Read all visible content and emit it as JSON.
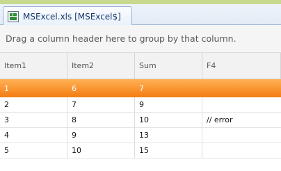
{
  "tab": {
    "label": "MSExcel.xls [MSExcel$]",
    "icon": "excel-sheet-icon"
  },
  "group_panel": {
    "text": "Drag a column header here to group by that column."
  },
  "grid": {
    "columns": [
      "Item1",
      "Item2",
      "Sum",
      "F4"
    ],
    "rows": [
      [
        "1",
        "6",
        "7",
        ""
      ],
      [
        "2",
        "7",
        "9",
        ""
      ],
      [
        "3",
        "8",
        "10",
        "// error"
      ],
      [
        "4",
        "9",
        "13",
        ""
      ],
      [
        "5",
        "10",
        "15",
        ""
      ]
    ],
    "selected_row": 0
  },
  "colors": {
    "selection_top": "#ffb155",
    "selection_bottom": "#f47c12",
    "accent_border": "#97b1d6"
  }
}
